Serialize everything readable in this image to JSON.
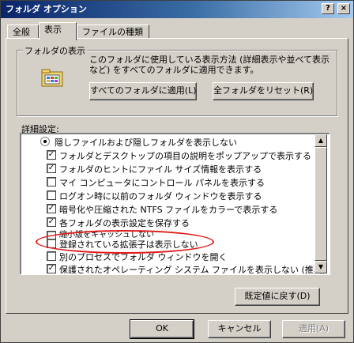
{
  "window": {
    "title": "フォルダ オプション",
    "help_label": "?",
    "close_label": "×"
  },
  "tabs": [
    {
      "label": "全般",
      "active": false
    },
    {
      "label": "表示",
      "active": true
    },
    {
      "label": "ファイルの種類",
      "active": false
    }
  ],
  "folder_view": {
    "legend": "フォルダの表示",
    "description_line1": "このフォルダに使用している表示方法 (詳細表示や並べて表示",
    "description_line2": "など) をすべてのフォルダに適用できます。",
    "apply_all_label": "すべてのフォルダに適用(L)",
    "reset_all_label": "全フォルダをリセット(R)"
  },
  "advanced": {
    "label": "詳細設定:",
    "items": [
      {
        "type": "radio",
        "checked": true,
        "label": "隠しファイルおよび隠しフォルダを表示しない"
      },
      {
        "type": "checkbox",
        "checked": true,
        "label": "フォルダとデスクトップの項目の説明をポップアップで表示する"
      },
      {
        "type": "checkbox",
        "checked": true,
        "label": "フォルダのヒントにファイル サイズ情報を表示する"
      },
      {
        "type": "checkbox",
        "checked": false,
        "label": "マイ コンピュータにコントロール パネルを表示する"
      },
      {
        "type": "checkbox",
        "checked": false,
        "label": "ログオン時に以前のフォルダ ウィンドウを表示する"
      },
      {
        "type": "checkbox",
        "checked": true,
        "label": "暗号化や圧縮された NTFS ファイルをカラーで表示する"
      },
      {
        "type": "checkbox",
        "checked": true,
        "label": "各フォルダの表示設定を保存する"
      },
      {
        "type": "checkbox",
        "checked": false,
        "label": "縮小版をキャッシュしない"
      },
      {
        "type": "checkbox",
        "checked": false,
        "label": "登録されている拡張子は表示しない"
      },
      {
        "type": "checkbox",
        "checked": false,
        "label": "別のプロセスでフォルダ ウィンドウを開く"
      },
      {
        "type": "checkbox",
        "checked": true,
        "label": "保護されたオペレーティング システム ファイルを表示しない (推奨)"
      }
    ],
    "restore_defaults_label": "既定値に戻す(D)"
  },
  "footer": {
    "ok_label": "OK",
    "cancel_label": "キャンセル",
    "apply_label": "適用(A)"
  },
  "colors": {
    "title_start": "#0a246a",
    "title_end": "#a6caf0",
    "face": "#d4d0c8",
    "highlight_ellipse": "#e01a1a"
  }
}
